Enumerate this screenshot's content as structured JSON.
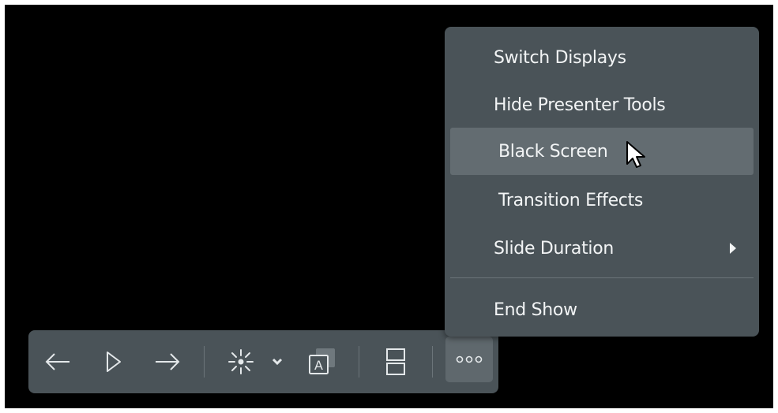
{
  "toolbar": {
    "buttons": [
      {
        "name": "previous",
        "icon": "arrow-left-icon"
      },
      {
        "name": "play",
        "icon": "play-icon"
      },
      {
        "name": "next",
        "icon": "arrow-right-icon"
      },
      {
        "name": "laser-pointer",
        "icon": "laser-pointer-icon"
      },
      {
        "name": "pointer-options",
        "icon": "chevron-down-icon"
      },
      {
        "name": "subtitles",
        "icon": "subtitles-icon"
      },
      {
        "name": "layout",
        "icon": "split-layout-icon"
      },
      {
        "name": "more",
        "icon": "more-dots-icon"
      }
    ]
  },
  "menu": {
    "items": [
      {
        "label": "Switch Displays"
      },
      {
        "label": "Hide Presenter Tools"
      },
      {
        "label": "Black Screen",
        "highlighted": true
      },
      {
        "label": "Transition Effects"
      },
      {
        "label": "Slide Duration",
        "has_submenu": true
      },
      {
        "label": "End Show"
      }
    ]
  },
  "colors": {
    "background": "#000000",
    "panel": "#4a5358",
    "highlight": "#636c71",
    "text": "#f2f4f5"
  }
}
